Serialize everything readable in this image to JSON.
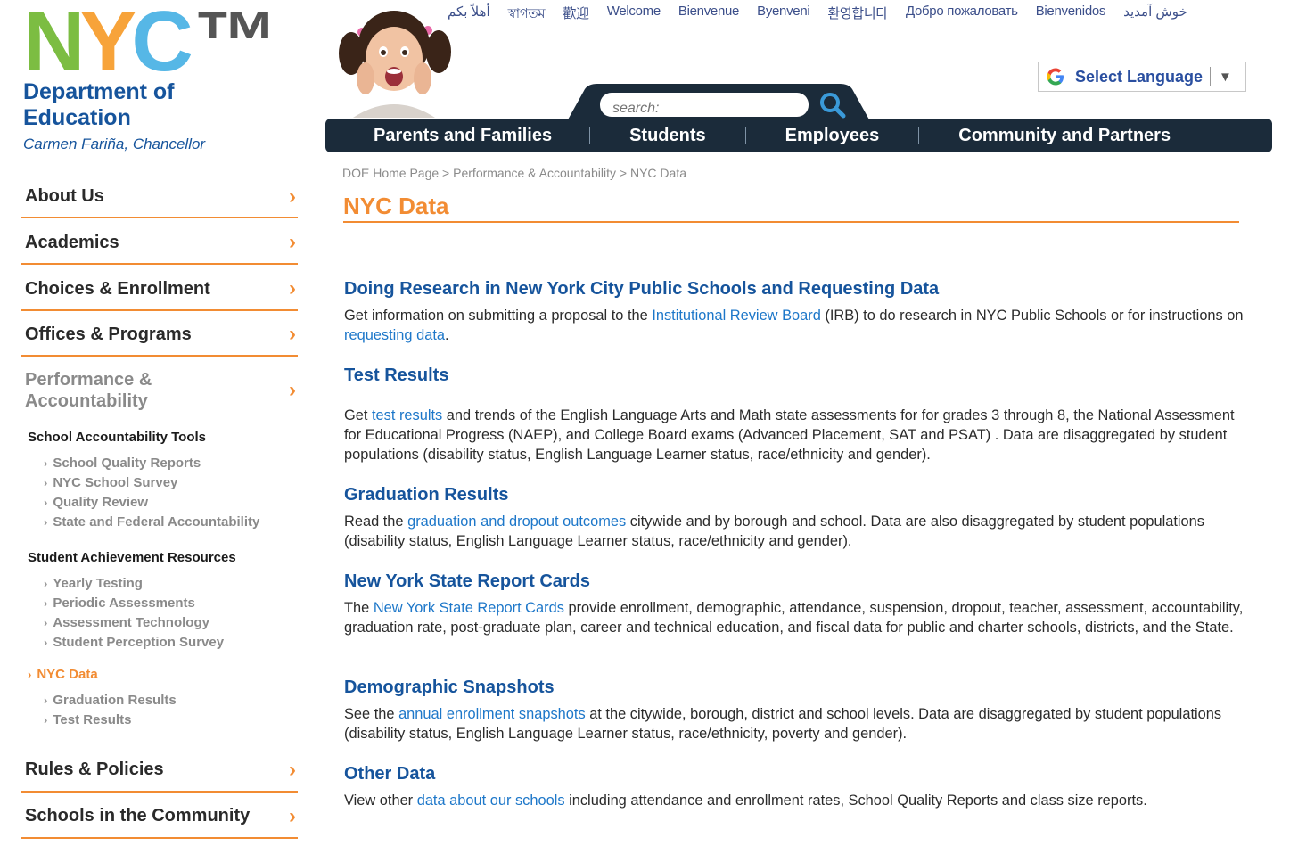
{
  "logo": {
    "letters": [
      "N",
      "Y",
      "C"
    ],
    "trademark": "™",
    "line1": "Department of",
    "line2": "Education",
    "chancellor": "Carmen Fariña, Chancellor"
  },
  "welcome": [
    "أهلاً بكم",
    "স্বাগতম",
    "歡迎",
    "Welcome",
    "Bienvenue",
    "Byenveni",
    "환영합니다",
    "Добро пожаловать",
    "Bienvenidos",
    "خوش آمدید"
  ],
  "language": {
    "label": "Select Language",
    "arrow": "▼"
  },
  "search": {
    "placeholder": "search:"
  },
  "nav": [
    "Parents and Families",
    "Students",
    "Employees",
    "Community and Partners"
  ],
  "sidebar": {
    "main": [
      "About Us",
      "Academics",
      "Choices & Enrollment",
      "Offices & Programs",
      "Performance & Accountability",
      "Rules & Policies",
      "Schools in the Community"
    ],
    "chevron": "›",
    "caret": "›",
    "group1_heading": "School Accountability Tools",
    "group1": [
      "School Quality Reports",
      "NYC School Survey",
      "Quality Review",
      "State and Federal Accountability"
    ],
    "group2_heading": "Student Achievement Resources",
    "group2": [
      "Yearly Testing",
      "Periodic Assessments",
      "Assessment Technology",
      "Student Perception Survey"
    ],
    "active": "NYC Data",
    "group3": [
      "Graduation Results",
      "Test Results"
    ]
  },
  "breadcrumb": {
    "home": "DOE Home Page",
    "parent": "Performance & Accountability",
    "current": "NYC Data",
    "sep": " > "
  },
  "page_title": "NYC Data",
  "sections": [
    {
      "heading": "Doing Research in New York City Public Schools and Requesting Data",
      "t1": "Get information on submitting a proposal to the ",
      "l1": "Institutional Review Board",
      "t2": " (IRB) to do research in NYC Public Schools or for instructions on ",
      "l2": "requesting data",
      "t3": "."
    },
    {
      "heading": "Test Results",
      "t1": "Get ",
      "l1": "test results",
      "t2": " and trends of the English Language Arts and Math state assessments for for grades 3 through 8, the National Assessment for Educational Progress (NAEP), and College Board exams (Advanced Placement, SAT and PSAT) . Data are disaggregated by student populations (disability status, English Language Learner status, race/ethnicity and gender)."
    },
    {
      "heading": "Graduation Results",
      "t1": "Read the ",
      "l1": "graduation and dropout outcomes",
      "t2": " citywide and by borough and school.  Data are also disaggregated by student populations (disability status, English Language Learner status, race/ethnicity and gender)."
    },
    {
      "heading": "New York State Report Cards",
      "t1": "The ",
      "l1": "New York State Report Cards",
      "t2": " provide enrollment, demographic, attendance, suspension, dropout, teacher, assessment, accountability, graduation rate, post-graduate plan, career and technical education, and fiscal data for public and charter schools, districts, and the State."
    },
    {
      "heading": "Demographic Snapshots",
      "t1": "See the ",
      "l1": "annual enrollment snapshots",
      "t2": " at the citywide, borough, district and school levels. Data are disaggregated by student populations (disability status, English Language Learner status, race/ethnicity, poverty and gender)."
    },
    {
      "heading": "Other Data",
      "t1": "View other ",
      "l1": "data about our schools",
      "t2": " including attendance and enrollment rates, School Quality Reports and class size reports."
    }
  ],
  "colors": {
    "orange": "#f28c33",
    "navy": "#1b2b3a",
    "heading_blue": "#16549c",
    "link_blue": "#1d77c9"
  }
}
